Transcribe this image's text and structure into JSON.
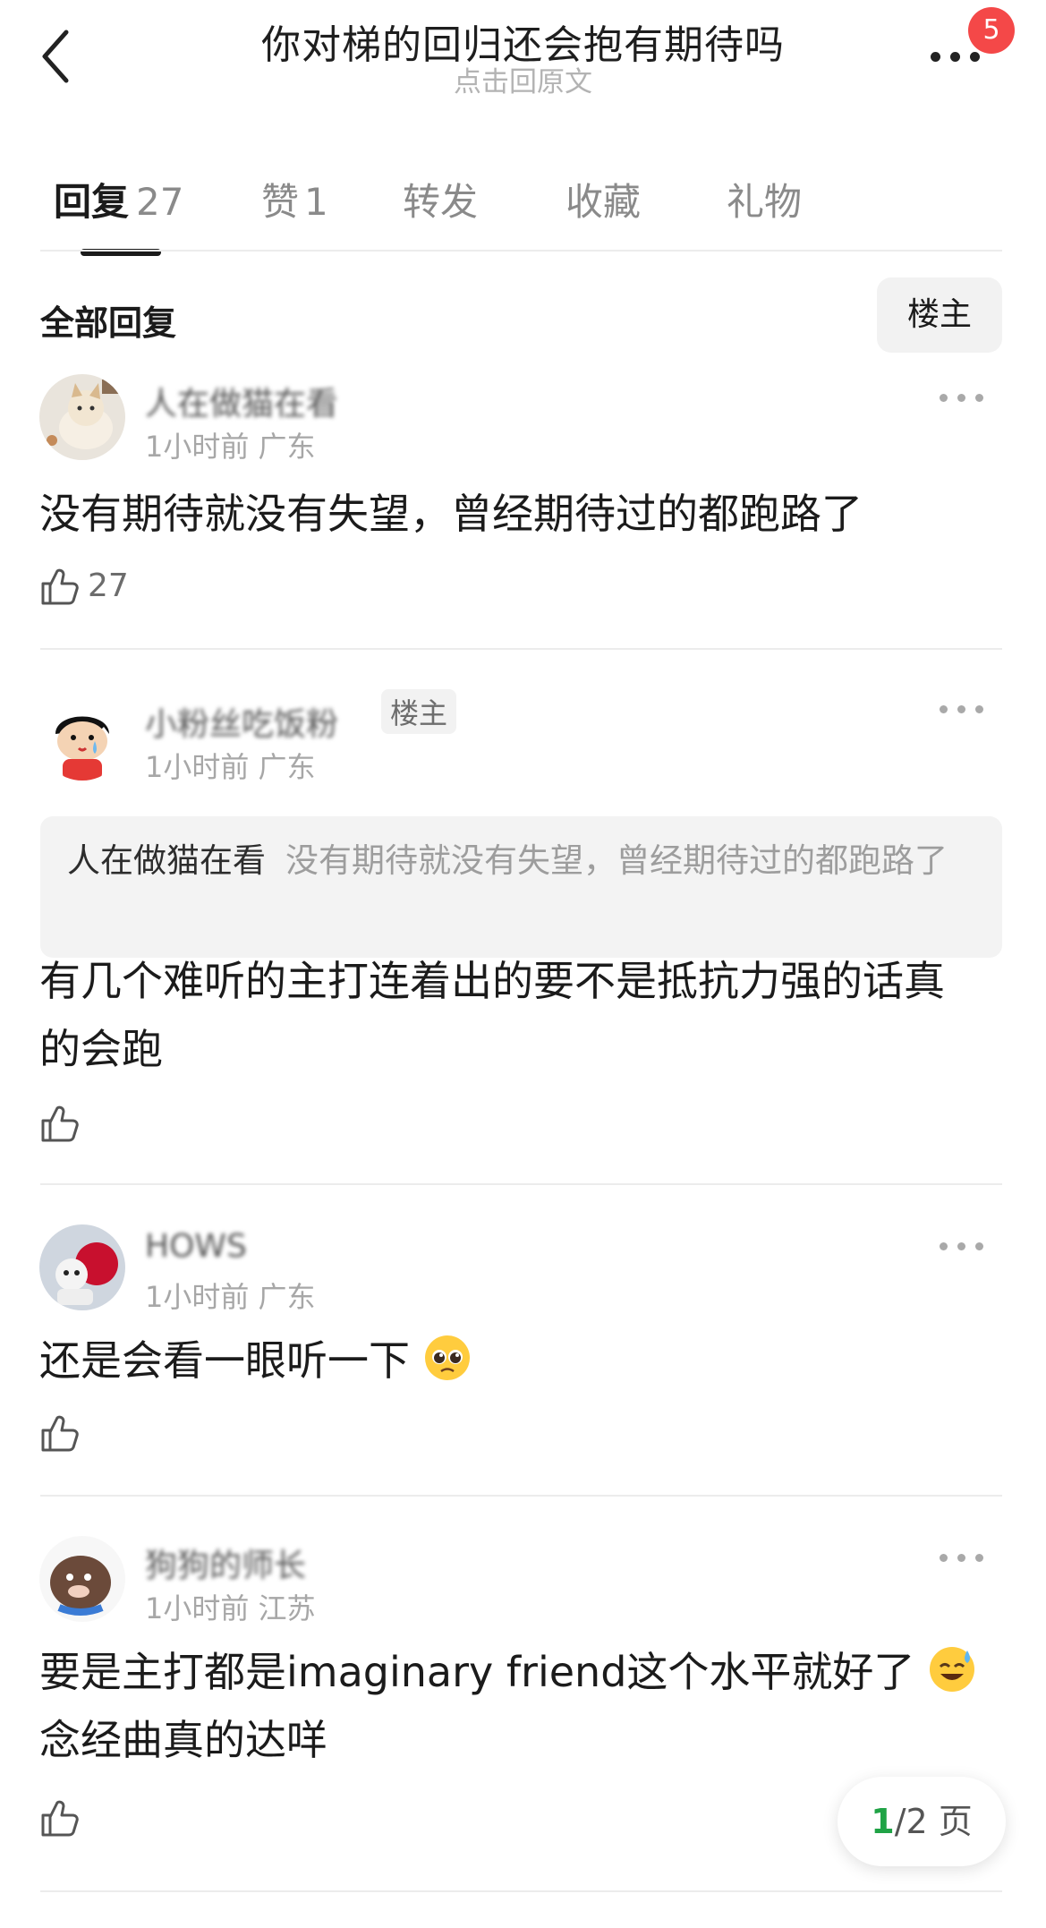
{
  "header": {
    "title": "你对梯的回归还会抱有期待吗",
    "subtitle": "点击回原文",
    "badge_count": "5"
  },
  "tabs": [
    {
      "label": "回复",
      "count": "27"
    },
    {
      "label": "赞",
      "count": "1"
    },
    {
      "label": "转发"
    },
    {
      "label": "收藏"
    },
    {
      "label": "礼物"
    }
  ],
  "section": {
    "title": "全部回复",
    "owner_filter": "楼主"
  },
  "comments": [
    {
      "username": "人在做猫在看",
      "time": "1小时前",
      "location": "广东",
      "text": "没有期待就没有失望，曾经期待过的都跑路了",
      "likes": "27"
    },
    {
      "username": "小粉丝吃饭粉",
      "owner_tag": "楼主",
      "time": "1小时前",
      "location": "广东",
      "quote_name": "人在做猫在看",
      "quote_text": "没有期待就没有失望，曾经期待过的都跑路了",
      "text_line1": "有几个难听的主打连着出的要不是抵抗力强的话真",
      "text_line2": "的会跑"
    },
    {
      "username": "HOWS",
      "time": "1小时前",
      "location": "广东",
      "text": "还是会看一眼听一下",
      "emoji": "pleading-face-emoji"
    },
    {
      "username": "狗狗的师长",
      "time": "1小时前",
      "location": "江苏",
      "text_line1": "要是主打都是imaginary friend这个水平就好了",
      "text_line2": "念经曲真的达咩",
      "emoji": "sweat-smile-emoji"
    }
  ],
  "pager": {
    "current": "1",
    "total": "/2 页"
  },
  "colors": {
    "badge": "#f44848",
    "pager_current": "#20a346"
  }
}
